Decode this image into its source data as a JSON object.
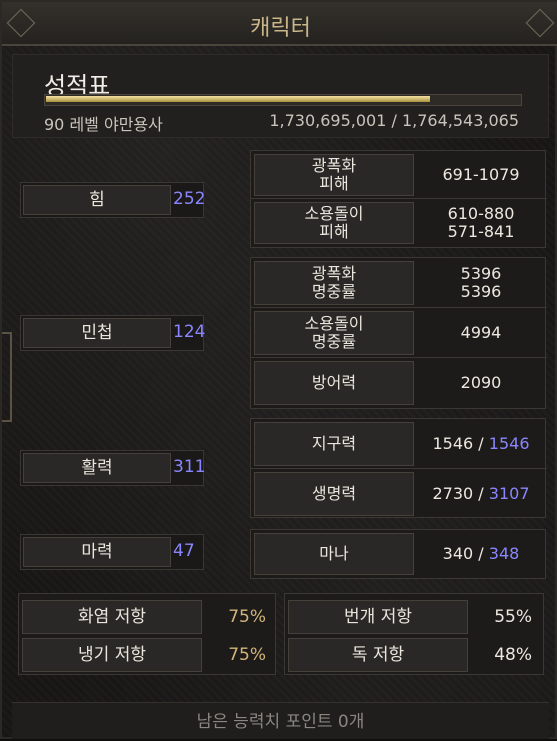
{
  "window": {
    "title": "캐릭터"
  },
  "header": {
    "title": "성적표",
    "level_class": "90 레벨 야만용사",
    "experience": "1,730,695,001 / 1,764,543,065",
    "xp_progress": 0.81
  },
  "stats": [
    {
      "label": "힘",
      "value": "252"
    },
    {
      "label": "민첩",
      "value": "124"
    },
    {
      "label": "활력",
      "value": "311"
    },
    {
      "label": "마력",
      "value": "47"
    }
  ],
  "damage": [
    {
      "label_line1": "광폭화",
      "label_line2": "피해",
      "value_line1": "691-1079",
      "value_line2": ""
    },
    {
      "label_line1": "소용돌이",
      "label_line2": "피해",
      "value_line1": "610-880",
      "value_line2": "571-841"
    }
  ],
  "accuracy": [
    {
      "label_line1": "광폭화",
      "label_line2": "명중률",
      "value_line1": "5396",
      "value_line2": "5396"
    },
    {
      "label_line1": "소용돌이",
      "label_line2": "명중률",
      "value_line1": "4994",
      "value_line2": ""
    },
    {
      "label_line1": "방어력",
      "label_line2": "",
      "value_line1": "2090",
      "value_line2": ""
    }
  ],
  "vitals": [
    {
      "label": "지구력",
      "current": "1546",
      "separator": " / ",
      "max": "1546"
    },
    {
      "label": "생명력",
      "current": "2730",
      "separator": " / ",
      "max": "3107"
    }
  ],
  "mana": {
    "label": "마나",
    "current": "340",
    "separator": " / ",
    "max": "348"
  },
  "resistances": [
    {
      "label": "화염 저항",
      "value": "75%"
    },
    {
      "label": "냉기 저항",
      "value": "75%"
    },
    {
      "label": "번개 저항",
      "value": "55%"
    },
    {
      "label": "독 저항",
      "value": "48%"
    }
  ],
  "footer": {
    "remaining_points": "남은 능력치 포인트 0개"
  },
  "colors": {
    "damage_green": "#2fd32b",
    "max_blue": "#8a86ff",
    "capped_res_gold": "#d3b47a",
    "title_gold": "#c9b789"
  }
}
